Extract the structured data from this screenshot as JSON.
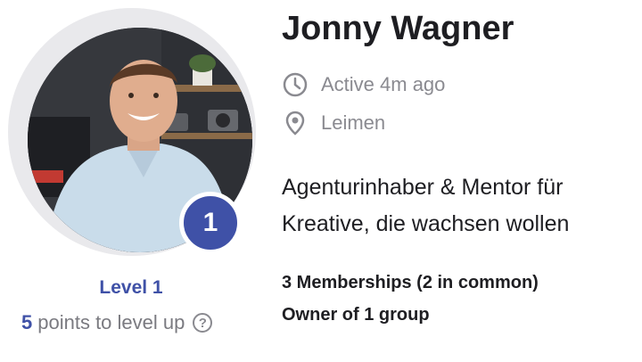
{
  "profile": {
    "name": "Jonny Wagner",
    "active_status": "Active 4m ago",
    "location": "Leimen",
    "bio": "Agenturinhaber & Mentor für Kreative, die wachsen wollen",
    "memberships": "3 Memberships (2 in common)",
    "ownership": "Owner of 1 group"
  },
  "level": {
    "badge_number": "1",
    "label": "Level 1",
    "points_to_level_up": "5",
    "points_suffix": "points to level up"
  },
  "colors": {
    "accent": "#3f51a7",
    "muted_text": "#8a8a90",
    "primary_text": "#1e1e22"
  },
  "icons": {
    "active": "clock-icon",
    "location": "map-pin-icon",
    "help": "help-circle-icon"
  }
}
